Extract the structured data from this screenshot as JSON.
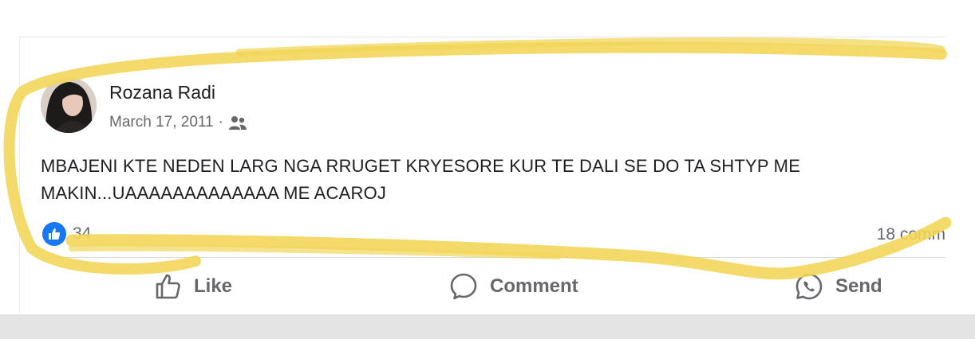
{
  "post": {
    "author": "Rozana Radi",
    "date": "March 17, 2011",
    "separator": "·",
    "audience_icon": "friends-icon",
    "text": "MBAJENI KTE NEDEN LARG NGA RRUGET KRYESORE KUR TE DALI SE DO TA SHTYP ME MAKIN...UAAAAAAAAAAAAA ME ACAROJ",
    "reactions_count": "34",
    "comments_count": "18 comm"
  },
  "actions": {
    "like": "Like",
    "comment": "Comment",
    "send": "Send"
  },
  "colors": {
    "highlight": "#f2d65a",
    "like_badge": "#1877f2",
    "secondary_text": "#65676b"
  }
}
